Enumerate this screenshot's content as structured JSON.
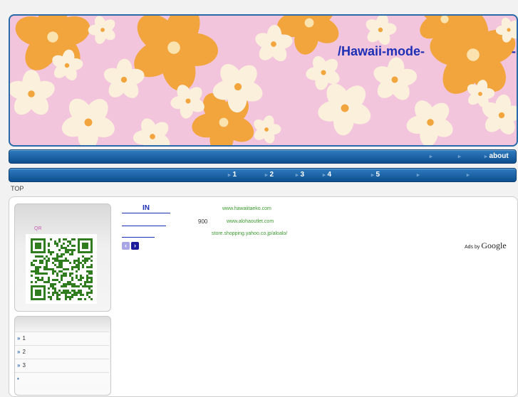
{
  "header": {
    "title": "/Hawaii-mode-",
    "title_tail": "-"
  },
  "nav_top": [
    {
      "arrow": "▹",
      "label": ""
    },
    {
      "arrow": "▹",
      "label": ""
    },
    {
      "arrow": "▹",
      "label": "about"
    }
  ],
  "nav_main": [
    {
      "arrow": "▹",
      "label": "1"
    },
    {
      "arrow": "▹",
      "label": "2"
    },
    {
      "arrow": "▹",
      "label": "3"
    },
    {
      "arrow": "▹",
      "label": "4"
    },
    {
      "arrow": "▹",
      "label": "5"
    },
    {
      "arrow": "▹",
      "label": ""
    },
    {
      "arrow": "▹",
      "label": ""
    }
  ],
  "breadcrumb": "TOP",
  "qr": {
    "label": "QR"
  },
  "side_menu": [
    {
      "chev": "»",
      "label": "1"
    },
    {
      "chev": "»",
      "label": "2"
    },
    {
      "chev": "»",
      "label": "3"
    },
    {
      "chev": "•",
      "label": ""
    }
  ],
  "ads": {
    "rows": [
      {
        "link": "IN",
        "price": "",
        "url": "www.hawaiitaeko.com"
      },
      {
        "link": "",
        "price": "900",
        "url": "www.alohaoutlet.com"
      },
      {
        "link": "",
        "price": "",
        "url": "store.shopping.yahoo.co.jp/aloalo/"
      }
    ],
    "prev": "‹",
    "next": "›",
    "ads_by": "Ads by",
    "brand": "Google"
  },
  "colors": {
    "nav": "#0e4f8e",
    "title": "#1d2fb5",
    "link": "#1d2fb5",
    "url": "#3a9a2e",
    "banner_bg": "#f3c5dc",
    "flower_orange": "#f2a53c",
    "flower_cream": "#fbf0dc"
  }
}
